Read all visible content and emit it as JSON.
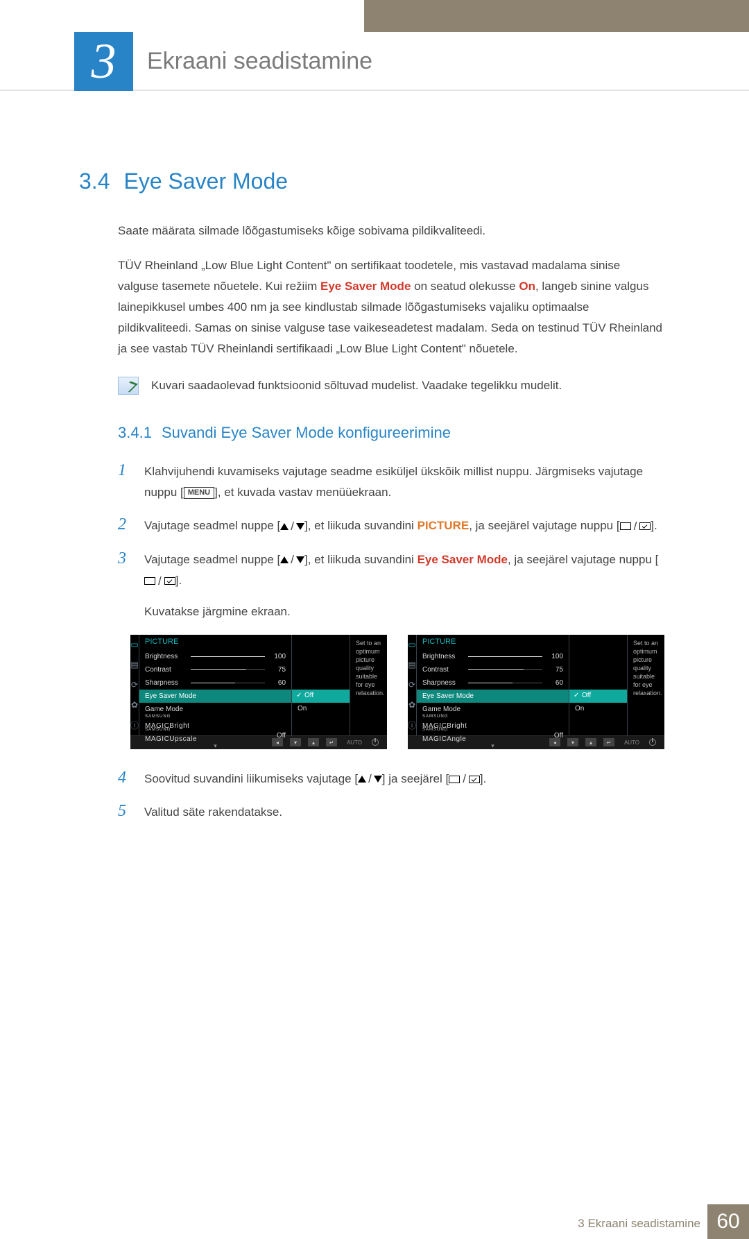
{
  "chapter": {
    "number": "3",
    "title": "Ekraani seadistamine"
  },
  "section": {
    "number": "3.4",
    "title": "Eye Saver Mode"
  },
  "intro_p1": "Saate määrata silmade lõõgastumiseks kõige sobivama pildikvaliteedi.",
  "intro_p2a": "TÜV Rheinland „Low Blue Light Content\" on sertifikaat toodetele, mis vastavad madalama sinise valguse tasemete nõuetele. Kui režiim ",
  "intro_p2_kw1": "Eye Saver Mode",
  "intro_p2b": " on seatud olekusse ",
  "intro_p2_kw2": "On",
  "intro_p2c": ", langeb sinine valgus lainepikkusel umbes 400 nm ja see kindlustab silmade lõõgastumiseks vajaliku optimaalse pildikvaliteedi. Samas on sinise valguse tase vaikeseadetest madalam. Seda on testinud TÜV Rheinland ja see vastab TÜV Rheinlandi sertifikaadi „Low Blue Light Content\" nõuetele.",
  "note": "Kuvari saadaolevad funktsioonid sõltuvad mudelist. Vaadake tegelikku mudelit.",
  "subsection": {
    "number": "3.4.1",
    "title": "Suvandi Eye Saver Mode konfigureerimine"
  },
  "steps": {
    "s1a": "Klahvijuhendi kuvamiseks vajutage seadme esiküljel ükskõik millist nuppu. Järgmiseks vajutage nuppu [",
    "s1_menu": "MENU",
    "s1b": "], et kuvada vastav menüüekraan.",
    "s2a": "Vajutage seadmel nuppe [",
    "s2b": "], et liikuda suvandini ",
    "s2_kw": "PICTURE",
    "s2c": ", ja seejärel vajutage nuppu [",
    "s2d": "].",
    "s3a": "Vajutage seadmel nuppe [",
    "s3b": "], et liikuda suvandini ",
    "s3_kw": "Eye Saver Mode",
    "s3c": ", ja seejärel vajutage nuppu [",
    "s3d": "].",
    "s3e": "Kuvatakse järgmine ekraan.",
    "s4a": "Soovitud suvandini liikumiseks vajutage [",
    "s4b": "] ja seejärel [",
    "s4c": "].",
    "s5": "Valitud säte rakendatakse."
  },
  "osd": {
    "title": "PICTURE",
    "desc": "Set to an optimum picture quality suitable for eye relaxation.",
    "rows": [
      {
        "label": "Brightness",
        "value": "100",
        "pct": 100
      },
      {
        "label": "Contrast",
        "value": "75",
        "pct": 75
      },
      {
        "label": "Sharpness",
        "value": "60",
        "pct": 60
      }
    ],
    "selected": "Eye Saver Mode",
    "after": [
      {
        "label": "Game Mode",
        "value": ""
      },
      {
        "label_html": "magic",
        "suffix": "Bright",
        "value": ""
      }
    ],
    "last_a": {
      "suffix": "Upscale",
      "value": "Off"
    },
    "last_b": {
      "suffix": "Angle",
      "value": "Off"
    },
    "options": {
      "off": "Off",
      "on": "On"
    },
    "foot_auto": "AUTO"
  },
  "footer": {
    "label": "3 Ekraani seadistamine",
    "page": "60"
  }
}
